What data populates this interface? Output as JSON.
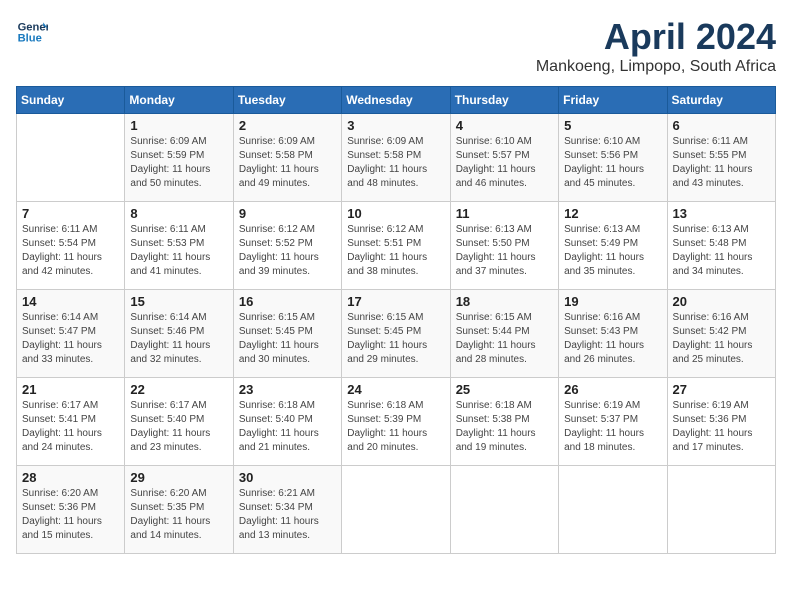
{
  "header": {
    "logo_line1": "General",
    "logo_line2": "Blue",
    "title": "April 2024",
    "subtitle": "Mankoeng, Limpopo, South Africa"
  },
  "weekdays": [
    "Sunday",
    "Monday",
    "Tuesday",
    "Wednesday",
    "Thursday",
    "Friday",
    "Saturday"
  ],
  "weeks": [
    [
      {
        "day": "",
        "info": ""
      },
      {
        "day": "1",
        "info": "Sunrise: 6:09 AM\nSunset: 5:59 PM\nDaylight: 11 hours\nand 50 minutes."
      },
      {
        "day": "2",
        "info": "Sunrise: 6:09 AM\nSunset: 5:58 PM\nDaylight: 11 hours\nand 49 minutes."
      },
      {
        "day": "3",
        "info": "Sunrise: 6:09 AM\nSunset: 5:58 PM\nDaylight: 11 hours\nand 48 minutes."
      },
      {
        "day": "4",
        "info": "Sunrise: 6:10 AM\nSunset: 5:57 PM\nDaylight: 11 hours\nand 46 minutes."
      },
      {
        "day": "5",
        "info": "Sunrise: 6:10 AM\nSunset: 5:56 PM\nDaylight: 11 hours\nand 45 minutes."
      },
      {
        "day": "6",
        "info": "Sunrise: 6:11 AM\nSunset: 5:55 PM\nDaylight: 11 hours\nand 43 minutes."
      }
    ],
    [
      {
        "day": "7",
        "info": "Sunrise: 6:11 AM\nSunset: 5:54 PM\nDaylight: 11 hours\nand 42 minutes."
      },
      {
        "day": "8",
        "info": "Sunrise: 6:11 AM\nSunset: 5:53 PM\nDaylight: 11 hours\nand 41 minutes."
      },
      {
        "day": "9",
        "info": "Sunrise: 6:12 AM\nSunset: 5:52 PM\nDaylight: 11 hours\nand 39 minutes."
      },
      {
        "day": "10",
        "info": "Sunrise: 6:12 AM\nSunset: 5:51 PM\nDaylight: 11 hours\nand 38 minutes."
      },
      {
        "day": "11",
        "info": "Sunrise: 6:13 AM\nSunset: 5:50 PM\nDaylight: 11 hours\nand 37 minutes."
      },
      {
        "day": "12",
        "info": "Sunrise: 6:13 AM\nSunset: 5:49 PM\nDaylight: 11 hours\nand 35 minutes."
      },
      {
        "day": "13",
        "info": "Sunrise: 6:13 AM\nSunset: 5:48 PM\nDaylight: 11 hours\nand 34 minutes."
      }
    ],
    [
      {
        "day": "14",
        "info": "Sunrise: 6:14 AM\nSunset: 5:47 PM\nDaylight: 11 hours\nand 33 minutes."
      },
      {
        "day": "15",
        "info": "Sunrise: 6:14 AM\nSunset: 5:46 PM\nDaylight: 11 hours\nand 32 minutes."
      },
      {
        "day": "16",
        "info": "Sunrise: 6:15 AM\nSunset: 5:45 PM\nDaylight: 11 hours\nand 30 minutes."
      },
      {
        "day": "17",
        "info": "Sunrise: 6:15 AM\nSunset: 5:45 PM\nDaylight: 11 hours\nand 29 minutes."
      },
      {
        "day": "18",
        "info": "Sunrise: 6:15 AM\nSunset: 5:44 PM\nDaylight: 11 hours\nand 28 minutes."
      },
      {
        "day": "19",
        "info": "Sunrise: 6:16 AM\nSunset: 5:43 PM\nDaylight: 11 hours\nand 26 minutes."
      },
      {
        "day": "20",
        "info": "Sunrise: 6:16 AM\nSunset: 5:42 PM\nDaylight: 11 hours\nand 25 minutes."
      }
    ],
    [
      {
        "day": "21",
        "info": "Sunrise: 6:17 AM\nSunset: 5:41 PM\nDaylight: 11 hours\nand 24 minutes."
      },
      {
        "day": "22",
        "info": "Sunrise: 6:17 AM\nSunset: 5:40 PM\nDaylight: 11 hours\nand 23 minutes."
      },
      {
        "day": "23",
        "info": "Sunrise: 6:18 AM\nSunset: 5:40 PM\nDaylight: 11 hours\nand 21 minutes."
      },
      {
        "day": "24",
        "info": "Sunrise: 6:18 AM\nSunset: 5:39 PM\nDaylight: 11 hours\nand 20 minutes."
      },
      {
        "day": "25",
        "info": "Sunrise: 6:18 AM\nSunset: 5:38 PM\nDaylight: 11 hours\nand 19 minutes."
      },
      {
        "day": "26",
        "info": "Sunrise: 6:19 AM\nSunset: 5:37 PM\nDaylight: 11 hours\nand 18 minutes."
      },
      {
        "day": "27",
        "info": "Sunrise: 6:19 AM\nSunset: 5:36 PM\nDaylight: 11 hours\nand 17 minutes."
      }
    ],
    [
      {
        "day": "28",
        "info": "Sunrise: 6:20 AM\nSunset: 5:36 PM\nDaylight: 11 hours\nand 15 minutes."
      },
      {
        "day": "29",
        "info": "Sunrise: 6:20 AM\nSunset: 5:35 PM\nDaylight: 11 hours\nand 14 minutes."
      },
      {
        "day": "30",
        "info": "Sunrise: 6:21 AM\nSunset: 5:34 PM\nDaylight: 11 hours\nand 13 minutes."
      },
      {
        "day": "",
        "info": ""
      },
      {
        "day": "",
        "info": ""
      },
      {
        "day": "",
        "info": ""
      },
      {
        "day": "",
        "info": ""
      }
    ]
  ]
}
